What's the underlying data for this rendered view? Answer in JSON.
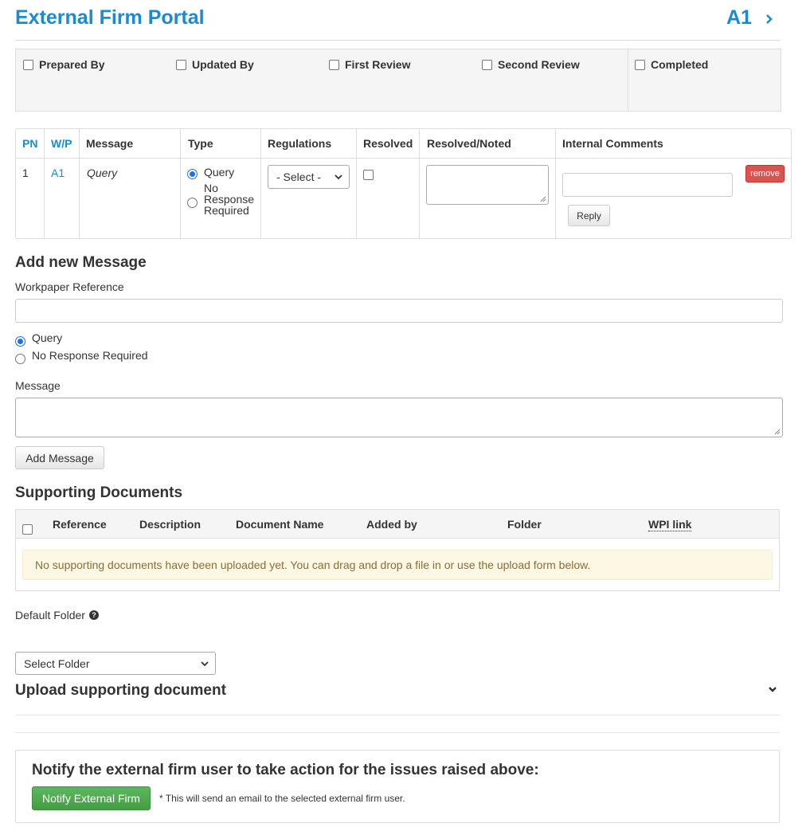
{
  "header": {
    "title": "External Firm Portal",
    "reference": "A1"
  },
  "signoffs": [
    "Prepared By",
    "Updated By",
    "First Review",
    "Second Review",
    "Completed"
  ],
  "messages_table": {
    "headers": [
      "PN",
      "W/P",
      "Message",
      "Type",
      "Regulations",
      "Resolved",
      "Resolved/Noted",
      "Internal Comments"
    ],
    "rows": [
      {
        "pn": "1",
        "wp": "A1",
        "message": "Query",
        "type_options": [
          "Query",
          "No Response Required"
        ],
        "type_selected": "Query",
        "regulations": "- Select -",
        "resolved": false,
        "remove_label": "remove",
        "reply_label": "Reply"
      }
    ]
  },
  "add_message": {
    "title": "Add new Message",
    "workpaper_label": "Workpaper Reference",
    "workpaper_value": "",
    "type_options": [
      "Query",
      "No Response Required"
    ],
    "type_selected": "Query",
    "message_label": "Message",
    "message_value": "",
    "button_label": "Add Message"
  },
  "supporting_documents": {
    "title": "Supporting Documents",
    "headers": [
      "Reference",
      "Description",
      "Document Name",
      "Added by",
      "Folder",
      "WPI link"
    ],
    "empty_notice": "No supporting documents have been uploaded yet. You can drag and drop a file in or use the upload form below."
  },
  "default_folder": {
    "label": "Default Folder",
    "selected": "Select Folder"
  },
  "upload": {
    "title": "Upload supporting document"
  },
  "notify": {
    "title": "Notify the external firm user to take action for the issues raised above:",
    "button_label": "Notify External Firm",
    "note": "* This will send an email to the selected external firm user."
  },
  "colors": {
    "link": "#1a8bd0",
    "danger": "#d9534f",
    "success": "#5cb85c",
    "warning_bg": "#fcf8e3"
  }
}
